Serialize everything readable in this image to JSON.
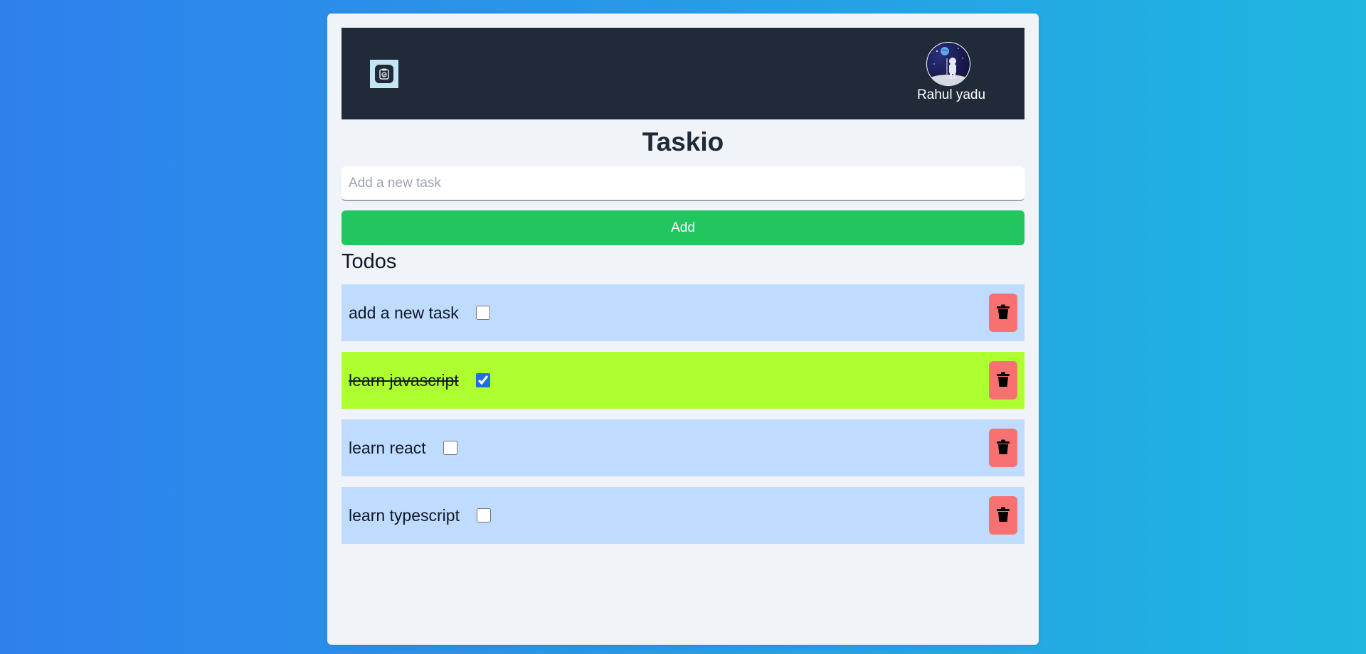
{
  "app": {
    "title": "Taskio"
  },
  "navbar": {
    "logo_icon": "clipboard-icon",
    "username": "Rahul yadu",
    "avatar": "astronaut-avatar"
  },
  "new_task": {
    "placeholder": "Add a new task",
    "value": "",
    "add_label": "Add"
  },
  "todos": {
    "section_title": "Todos",
    "delete_icon": "trash-icon",
    "items": [
      {
        "text": "add a new task",
        "completed": false
      },
      {
        "text": "learn javascript",
        "completed": true
      },
      {
        "text": "learn react",
        "completed": false
      },
      {
        "text": "learn typescript",
        "completed": false
      }
    ]
  },
  "colors": {
    "navbar_bg": "#212a38",
    "add_button": "#22c55e",
    "todo_bg": "#bfdbfe",
    "todo_done_bg": "#adff2f",
    "delete_button": "#f87171"
  }
}
